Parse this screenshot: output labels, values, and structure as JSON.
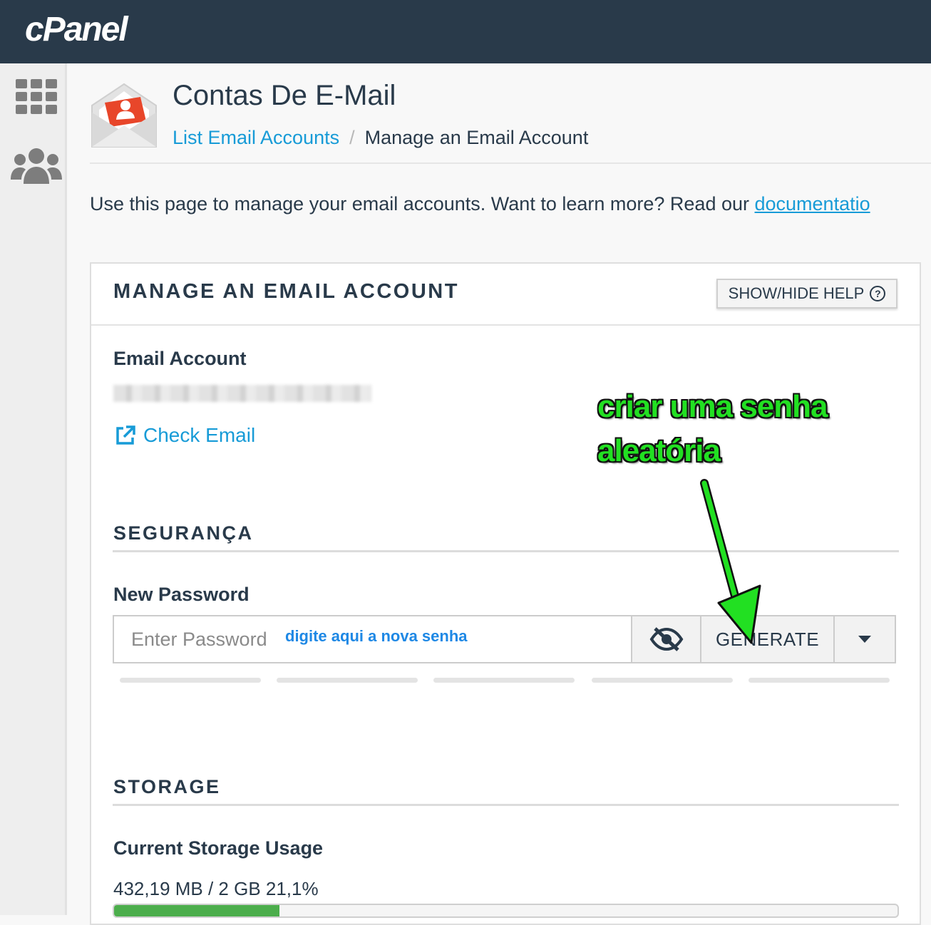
{
  "app": {
    "logo": "cPanel"
  },
  "sidebar": {
    "items": [
      {
        "icon": "grid-icon"
      },
      {
        "icon": "users-icon"
      }
    ]
  },
  "header": {
    "title": "Contas De E-Mail",
    "breadcrumb": {
      "link": "List Email Accounts",
      "separator": "/",
      "current": "Manage an Email Account"
    }
  },
  "intro": {
    "text": "Use this page to manage your email accounts. Want to learn more? Read our ",
    "link": "documentatio"
  },
  "panel": {
    "title": "MANAGE AN EMAIL ACCOUNT",
    "help_button": "SHOW/HIDE HELP",
    "help_icon": "?",
    "email_label": "Email Account",
    "check_email": "Check Email",
    "security": {
      "title": "SEGURANÇA",
      "new_password_label": "New Password",
      "password_placeholder": "Enter Password",
      "generate_label": "GENERATE"
    },
    "storage": {
      "title": "STORAGE",
      "usage_label": "Current Storage Usage",
      "usage_text": "432,19 MB / 2 GB 21,1%",
      "usage_fraction": 0.211
    }
  },
  "annotations": {
    "hint": "digite aqui a nova senha",
    "callout_line1": "criar uma senha",
    "callout_line2": "aleatória"
  },
  "colors": {
    "topbar": "#293a4a",
    "link": "#179bd7",
    "annotation_green": "#22e022",
    "storage_fill": "#4cae4c"
  }
}
